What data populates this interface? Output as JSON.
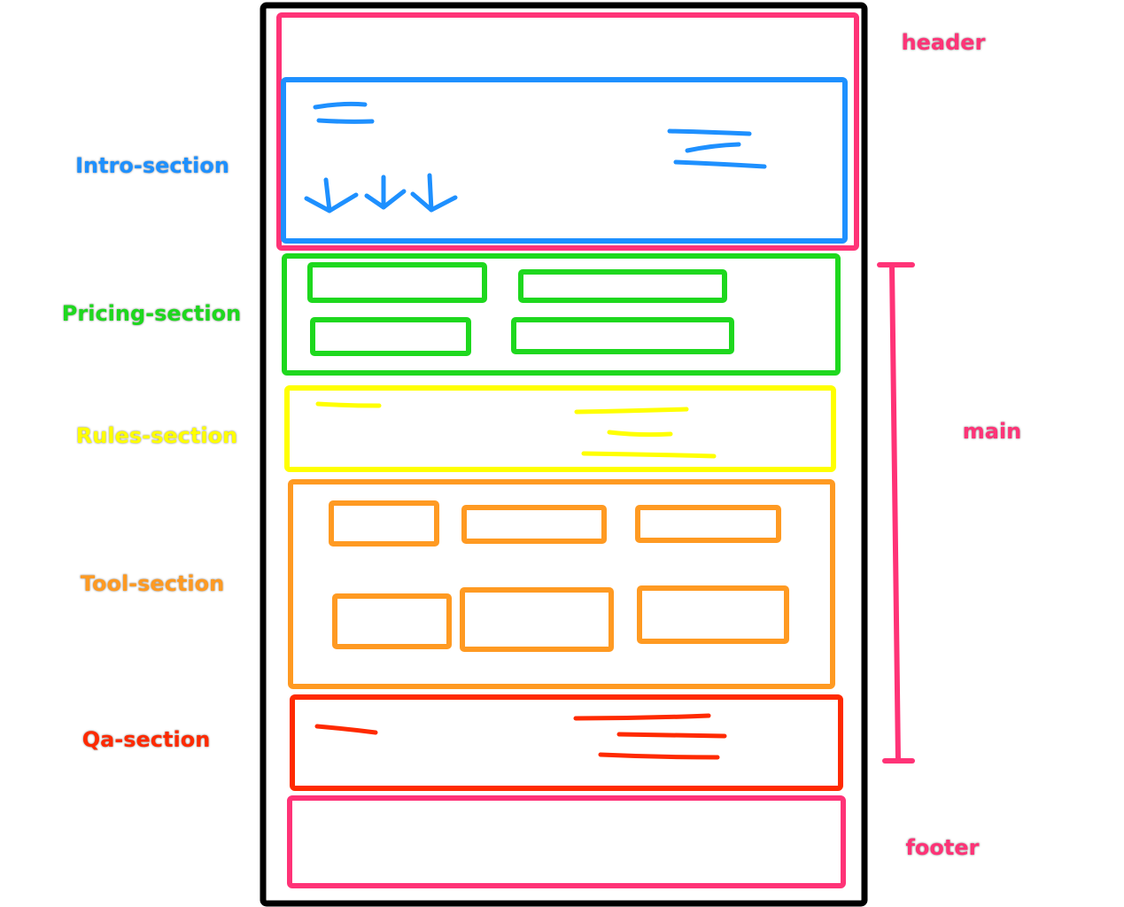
{
  "labels": {
    "header": "header",
    "intro": "Intro-section",
    "pricing": "Pricing-section",
    "rules": "Rules-section",
    "tool": "Tool-section",
    "qa": "Qa-section",
    "main": "main",
    "footer": "footer"
  },
  "colors": {
    "outline": "#000000",
    "header": "#ff3377",
    "intro": "#1e90ff",
    "pricing": "#1ed81e",
    "rules": "#ffff00",
    "tool": "#ff9a22",
    "qa": "#ff2a00",
    "main": "#ff3377",
    "footer": "#ff3377"
  }
}
